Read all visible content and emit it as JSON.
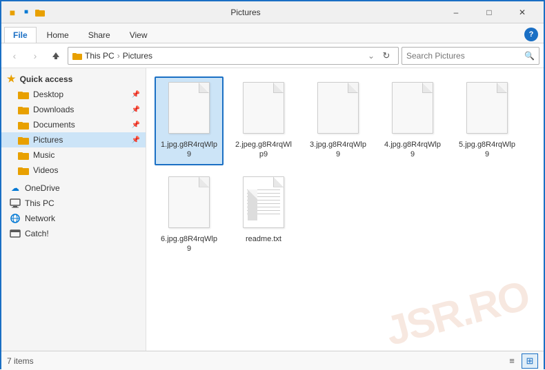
{
  "titleBar": {
    "title": "Pictures",
    "minimizeLabel": "–",
    "maximizeLabel": "□",
    "closeLabel": "✕"
  },
  "ribbon": {
    "tabs": [
      "File",
      "Home",
      "Share",
      "View"
    ],
    "activeTab": "File",
    "helpLabel": "?"
  },
  "toolbar": {
    "backLabel": "‹",
    "forwardLabel": "›",
    "upLabel": "↑",
    "breadcrumbs": [
      "This PC",
      "Pictures"
    ],
    "chevronLabel": "⌄",
    "refreshLabel": "↻",
    "searchPlaceholder": "Search Pictures"
  },
  "sidebar": {
    "quickAccessLabel": "Quick access",
    "items": [
      {
        "id": "desktop",
        "label": "Desktop",
        "pinned": true,
        "type": "folder"
      },
      {
        "id": "downloads",
        "label": "Downloads",
        "pinned": true,
        "type": "folder"
      },
      {
        "id": "documents",
        "label": "Documents",
        "pinned": true,
        "type": "folder"
      },
      {
        "id": "pictures",
        "label": "Pictures",
        "pinned": true,
        "type": "folder",
        "active": true
      },
      {
        "id": "music",
        "label": "Music",
        "pinned": false,
        "type": "folder"
      },
      {
        "id": "videos",
        "label": "Videos",
        "pinned": false,
        "type": "folder"
      }
    ],
    "oneDriveLabel": "OneDrive",
    "thisPcLabel": "This PC",
    "networkLabel": "Network",
    "catchLabel": "Catch!"
  },
  "files": [
    {
      "id": "file1",
      "name": "1.jpg.g8R4rqWlp9",
      "type": "doc",
      "selected": true
    },
    {
      "id": "file2",
      "name": "2.jpeg.g8R4rqWlp9",
      "type": "doc",
      "selected": false
    },
    {
      "id": "file3",
      "name": "3.jpg.g8R4rqWlp9",
      "type": "doc",
      "selected": false
    },
    {
      "id": "file4",
      "name": "4.jpg.g8R4rqWlp9",
      "type": "doc",
      "selected": false
    },
    {
      "id": "file5",
      "name": "5.jpg.g8R4rqWlp9",
      "type": "doc",
      "selected": false
    },
    {
      "id": "file6",
      "name": "6.jpg.g8R4rqWlp9",
      "type": "doc",
      "selected": false
    },
    {
      "id": "file7",
      "name": "readme.txt",
      "type": "lined-doc",
      "selected": false
    }
  ],
  "statusBar": {
    "itemCount": "7 items",
    "listViewLabel": "≡",
    "gridViewLabel": "⊞"
  },
  "watermark": "JSR.RO"
}
